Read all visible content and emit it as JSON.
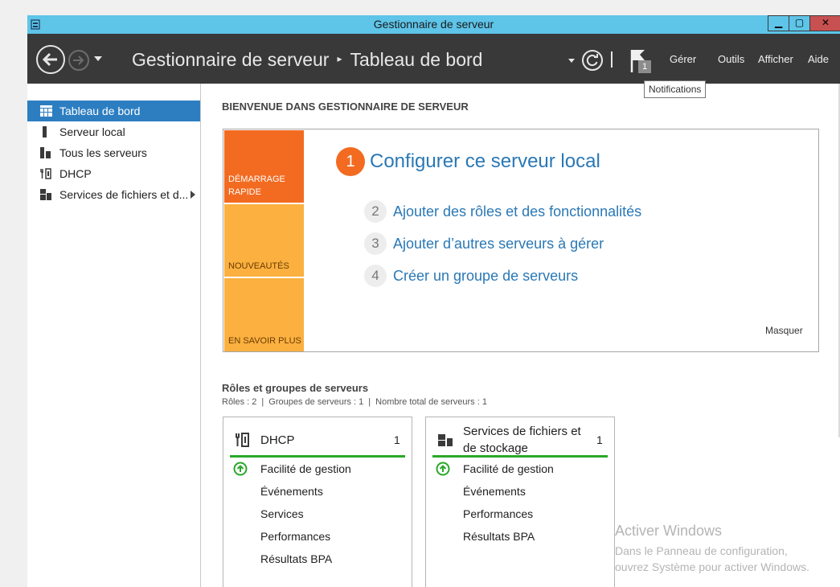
{
  "window": {
    "title": "Gestionnaire de serveur",
    "min_label": "▁",
    "max_label": "▢",
    "close_label": "✕"
  },
  "toolbar": {
    "crumb_root": "Gestionnaire de serveur",
    "crumb_sep": "▸",
    "crumb_current": "Tableau de bord",
    "notif_count": "1",
    "menus": {
      "gerer": "Gérer",
      "outils": "Outils",
      "afficher": "Afficher",
      "aide": "Aide"
    },
    "tooltip": "Notifications"
  },
  "sidebar": {
    "items": [
      {
        "label": "Tableau de bord",
        "icon": "dashboard-icon",
        "active": true
      },
      {
        "label": "Serveur local",
        "icon": "server-icon"
      },
      {
        "label": "Tous les serveurs",
        "icon": "servers-icon"
      },
      {
        "label": "DHCP",
        "icon": "dhcp-icon"
      },
      {
        "label": "Services de fichiers et d...",
        "icon": "file-services-icon",
        "has_submenu": true
      }
    ]
  },
  "main": {
    "welcome": "BIENVENUE DANS GESTIONNAIRE DE SERVEUR",
    "tiles": {
      "quick_start": "DÉMARRAGE RAPIDE",
      "news": "NOUVEAUTÉS",
      "learn": "EN SAVOIR PLUS"
    },
    "steps": [
      {
        "num": "1",
        "label": "Configurer ce serveur local"
      },
      {
        "num": "2",
        "label": "Ajouter des rôles et des fonctionnalités"
      },
      {
        "num": "3",
        "label": "Ajouter d’autres serveurs à gérer"
      },
      {
        "num": "4",
        "label": "Créer un groupe de serveurs"
      }
    ],
    "hide": "Masquer",
    "roles": {
      "title": "Rôles et groupes de serveurs",
      "roles_count": "Rôles : 2",
      "groups_count": "Groupes de serveurs : 1",
      "total_count": "Nombre total de serveurs : 1"
    },
    "cards": [
      {
        "title": "DHCP",
        "count": "1",
        "lines": [
          "Facilité de gestion",
          "Événements",
          "Services",
          "Performances",
          "Résultats BPA"
        ]
      },
      {
        "title_line1": "Services de fichiers et",
        "title_line2": "de stockage",
        "count": "1",
        "lines": [
          "Facilité de gestion",
          "Événements",
          "Performances",
          "Résultats BPA"
        ]
      }
    ]
  },
  "watermark": {
    "line1": "Activer Windows",
    "line2": "Dans le Panneau de configuration,",
    "line3": "ouvrez Système pour activer Windows."
  },
  "colors": {
    "titlebar": "#5ec4e8",
    "toolbar": "#393939",
    "active_item": "#2d7ec1",
    "accent_orange": "#f26b21",
    "tile_yellow": "#fbb040",
    "link_blue": "#2a78b5",
    "status_green": "#2aa82a"
  }
}
